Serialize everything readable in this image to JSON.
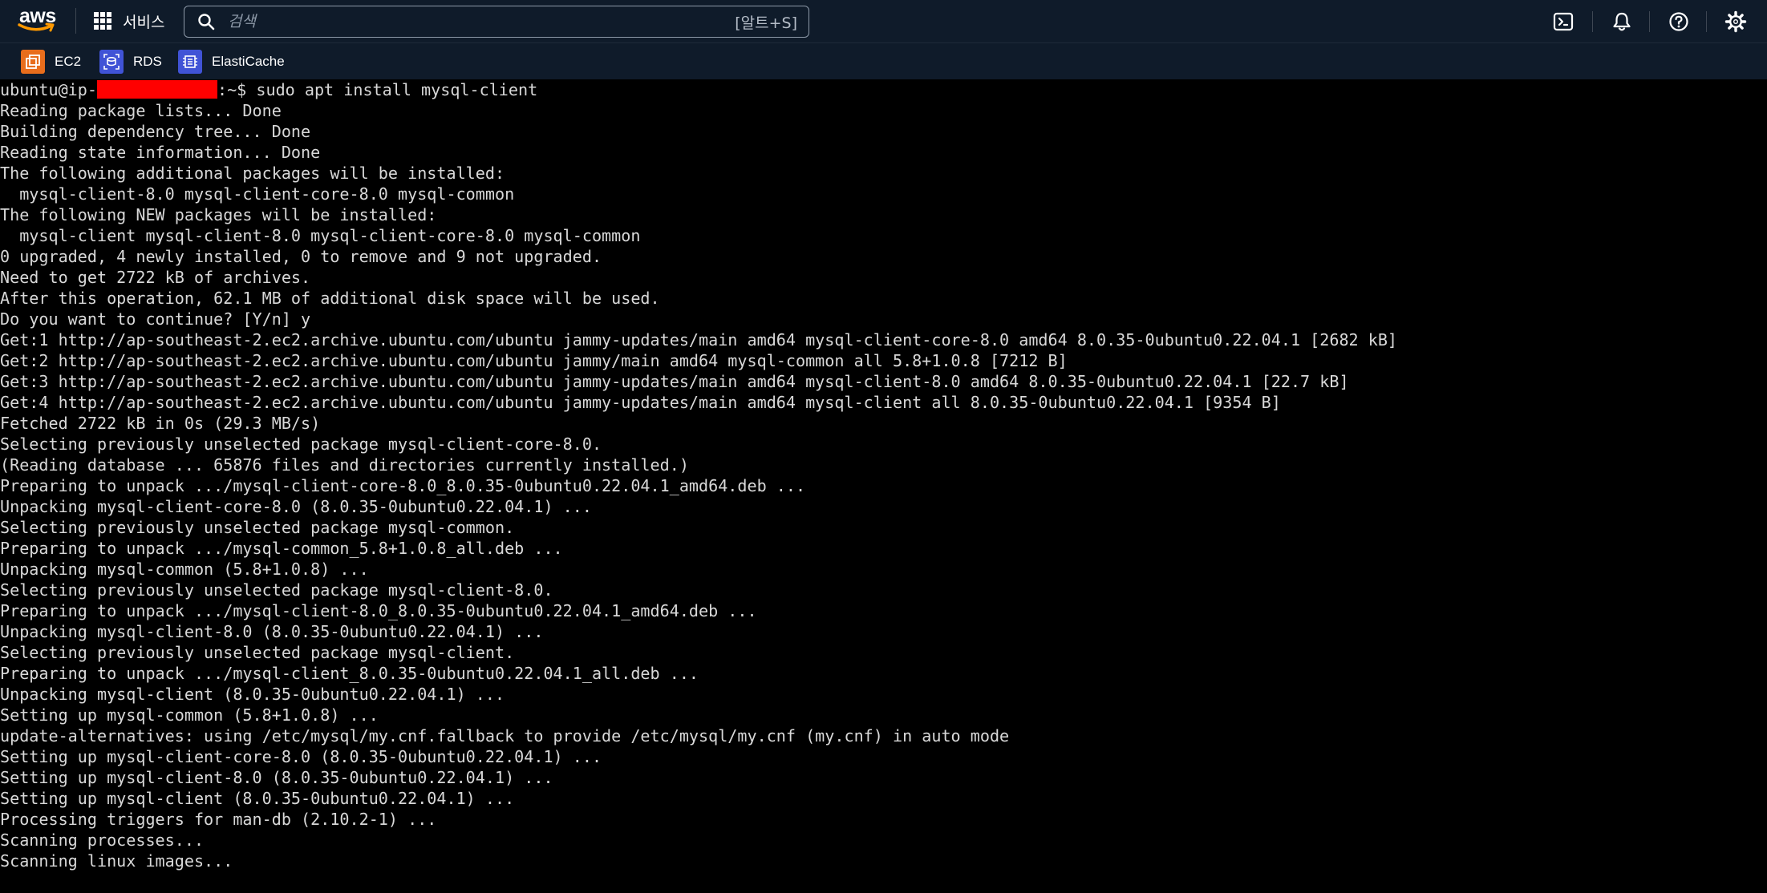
{
  "header": {
    "logo_text": "aws",
    "services_label": "서비스",
    "search_placeholder": "검색",
    "search_shortcut": "[알트+S]",
    "icons": [
      "cloudshell-icon",
      "bell-icon",
      "help-icon",
      "settings-icon"
    ]
  },
  "favorites": [
    {
      "label": "EC2",
      "icon": "ec2-icon",
      "color": "#e86d1c"
    },
    {
      "label": "RDS",
      "icon": "rds-icon",
      "color": "#4053d6"
    },
    {
      "label": "ElastiCache",
      "icon": "elasticache-icon",
      "color": "#4053d6"
    }
  ],
  "terminal": {
    "prompt_user": "ubuntu@ip-",
    "prompt_rest": ":~$ sudo apt install mysql-client",
    "redaction_color": "#ff0000",
    "lines": [
      "Reading package lists... Done",
      "Building dependency tree... Done",
      "Reading state information... Done",
      "The following additional packages will be installed:",
      "  mysql-client-8.0 mysql-client-core-8.0 mysql-common",
      "The following NEW packages will be installed:",
      "  mysql-client mysql-client-8.0 mysql-client-core-8.0 mysql-common",
      "0 upgraded, 4 newly installed, 0 to remove and 9 not upgraded.",
      "Need to get 2722 kB of archives.",
      "After this operation, 62.1 MB of additional disk space will be used.",
      "Do you want to continue? [Y/n] y",
      "Get:1 http://ap-southeast-2.ec2.archive.ubuntu.com/ubuntu jammy-updates/main amd64 mysql-client-core-8.0 amd64 8.0.35-0ubuntu0.22.04.1 [2682 kB]",
      "Get:2 http://ap-southeast-2.ec2.archive.ubuntu.com/ubuntu jammy/main amd64 mysql-common all 5.8+1.0.8 [7212 B]",
      "Get:3 http://ap-southeast-2.ec2.archive.ubuntu.com/ubuntu jammy-updates/main amd64 mysql-client-8.0 amd64 8.0.35-0ubuntu0.22.04.1 [22.7 kB]",
      "Get:4 http://ap-southeast-2.ec2.archive.ubuntu.com/ubuntu jammy-updates/main amd64 mysql-client all 8.0.35-0ubuntu0.22.04.1 [9354 B]",
      "Fetched 2722 kB in 0s (29.3 MB/s)",
      "Selecting previously unselected package mysql-client-core-8.0.",
      "(Reading database ... 65876 files and directories currently installed.)",
      "Preparing to unpack .../mysql-client-core-8.0_8.0.35-0ubuntu0.22.04.1_amd64.deb ...",
      "Unpacking mysql-client-core-8.0 (8.0.35-0ubuntu0.22.04.1) ...",
      "Selecting previously unselected package mysql-common.",
      "Preparing to unpack .../mysql-common_5.8+1.0.8_all.deb ...",
      "Unpacking mysql-common (5.8+1.0.8) ...",
      "Selecting previously unselected package mysql-client-8.0.",
      "Preparing to unpack .../mysql-client-8.0_8.0.35-0ubuntu0.22.04.1_amd64.deb ...",
      "Unpacking mysql-client-8.0 (8.0.35-0ubuntu0.22.04.1) ...",
      "Selecting previously unselected package mysql-client.",
      "Preparing to unpack .../mysql-client_8.0.35-0ubuntu0.22.04.1_all.deb ...",
      "Unpacking mysql-client (8.0.35-0ubuntu0.22.04.1) ...",
      "Setting up mysql-common (5.8+1.0.8) ...",
      "update-alternatives: using /etc/mysql/my.cnf.fallback to provide /etc/mysql/my.cnf (my.cnf) in auto mode",
      "Setting up mysql-client-core-8.0 (8.0.35-0ubuntu0.22.04.1) ...",
      "Setting up mysql-client-8.0 (8.0.35-0ubuntu0.22.04.1) ...",
      "Setting up mysql-client (8.0.35-0ubuntu0.22.04.1) ...",
      "Processing triggers for man-db (2.10.2-1) ...",
      "Scanning processes...",
      "Scanning linux images..."
    ]
  }
}
